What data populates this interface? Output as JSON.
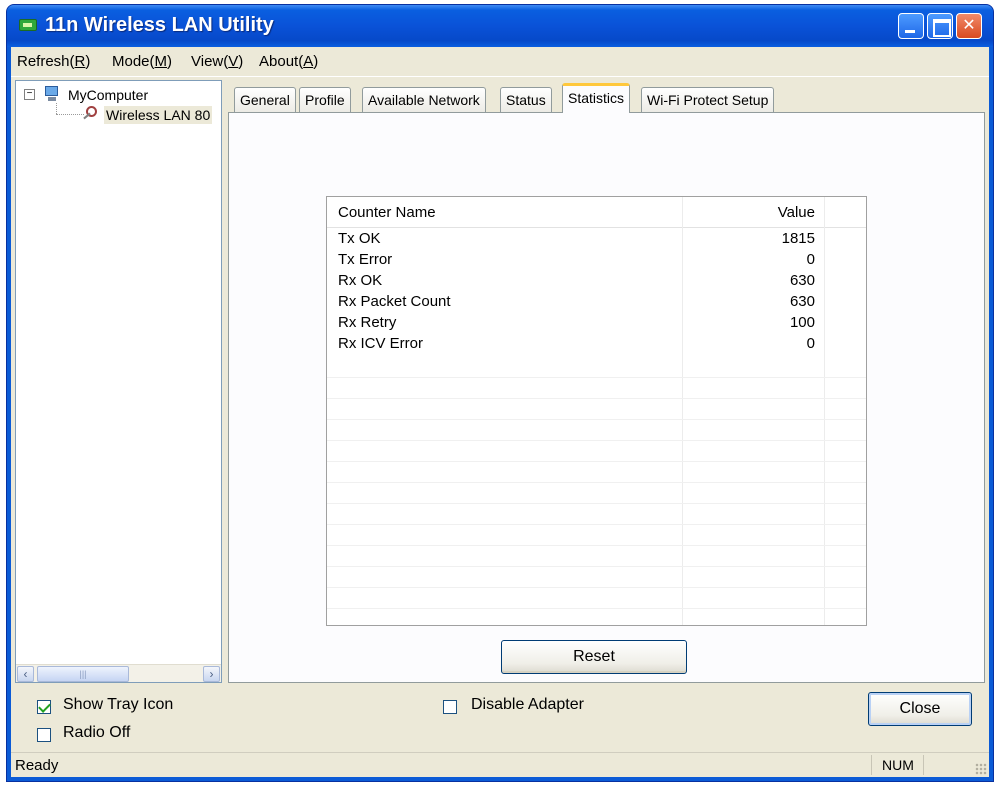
{
  "window": {
    "title": "11n Wireless LAN Utility"
  },
  "menu": [
    {
      "label": "Refresh(R)",
      "text": "Refresh(",
      "key": "R",
      "tail": ")"
    },
    {
      "label": "Mode(M)",
      "text": "Mode(",
      "key": "M",
      "tail": ")"
    },
    {
      "label": "View(V)",
      "text": "View(",
      "key": "V",
      "tail": ")"
    },
    {
      "label": "About(A)",
      "text": "About(",
      "key": "A",
      "tail": ")"
    }
  ],
  "tree": {
    "root": "MyComputer",
    "child": "Wireless LAN 80"
  },
  "tabs": [
    "General",
    "Profile",
    "Available Network",
    "Status",
    "Statistics",
    "Wi-Fi Protect Setup"
  ],
  "active_tab": "Statistics",
  "statistics": {
    "columns": {
      "name": "Counter Name",
      "value": "Value"
    },
    "rows": [
      {
        "name": "Tx OK",
        "value": "1815"
      },
      {
        "name": "Tx Error",
        "value": "0"
      },
      {
        "name": "Rx OK",
        "value": "630"
      },
      {
        "name": "Rx Packet Count",
        "value": "630"
      },
      {
        "name": "Rx Retry",
        "value": "100"
      },
      {
        "name": "Rx ICV Error",
        "value": "0"
      }
    ],
    "reset_label": "Reset"
  },
  "options": {
    "show_tray_icon": {
      "label": "Show Tray Icon",
      "checked": true
    },
    "radio_off": {
      "label": "Radio Off",
      "checked": false
    },
    "disable_adapter": {
      "label": "Disable Adapter",
      "checked": false
    }
  },
  "close_label": "Close",
  "status": {
    "text": "Ready",
    "num": "NUM"
  }
}
